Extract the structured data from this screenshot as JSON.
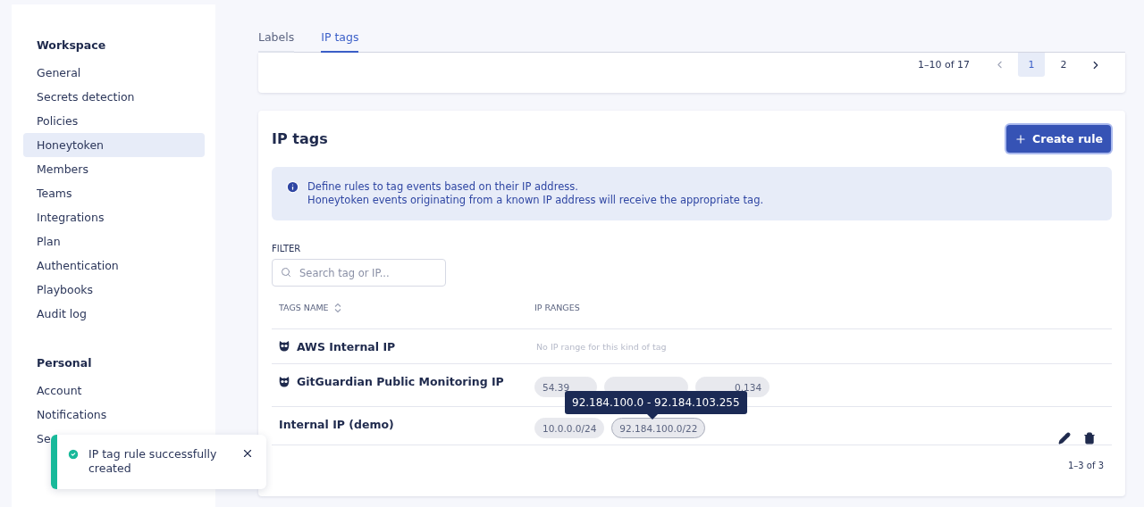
{
  "sidebar": {
    "sections": [
      {
        "title": "Workspace",
        "items": [
          {
            "label": "General",
            "selected": false
          },
          {
            "label": "Secrets detection",
            "selected": false
          },
          {
            "label": "Policies",
            "selected": false
          },
          {
            "label": "Honeytoken",
            "selected": true
          },
          {
            "label": "Members",
            "selected": false
          },
          {
            "label": "Teams",
            "selected": false
          },
          {
            "label": "Integrations",
            "selected": false
          },
          {
            "label": "Plan",
            "selected": false
          },
          {
            "label": "Authentication",
            "selected": false
          },
          {
            "label": "Playbooks",
            "selected": false
          },
          {
            "label": "Audit log",
            "selected": false
          }
        ]
      },
      {
        "title": "Personal",
        "items": [
          {
            "label": "Account",
            "selected": false
          },
          {
            "label": "Notifications",
            "selected": false
          },
          {
            "label": "Se",
            "selected": false
          }
        ]
      }
    ]
  },
  "tabs": [
    {
      "label": "Labels",
      "selected": false
    },
    {
      "label": "IP tags",
      "selected": true
    }
  ],
  "top_pagination": {
    "range": "1–10 of 17",
    "pages": [
      {
        "label": "1",
        "selected": true
      },
      {
        "label": "2",
        "selected": false
      }
    ]
  },
  "ip_tags": {
    "title": "IP tags",
    "create_button": "Create rule",
    "info": [
      "Define rules to tag events based on their IP address.",
      "Honeytoken events originating from a known IP address will receive the appropriate tag."
    ],
    "filter": {
      "label": "FILTER",
      "placeholder": "Search tag or IP..."
    },
    "columns": [
      "TAGS NAME",
      "IP RANGES"
    ],
    "rows": [
      {
        "name": "AWS Internal IP",
        "builtin": true,
        "empty_note": "No IP range for this kind of tag"
      },
      {
        "name": "GitGuardian Public Monitoring IP",
        "builtin": true,
        "ranges": [
          {
            "text": "54.39",
            "cut_left": false,
            "cut_right": true
          },
          {
            "cut_left": true,
            "cut_right": true
          },
          {
            "text": "0.134",
            "cut_left": true,
            "cut_right": false
          }
        ]
      },
      {
        "name": "Internal IP (demo)",
        "builtin": false,
        "editable": true,
        "ranges": [
          {
            "text": "10.0.0.0/24",
            "hovered": false
          },
          {
            "text": "92.184.100.0/22",
            "hovered": true
          }
        ],
        "tooltip": "92.184.100.0 - 92.184.103.255"
      }
    ],
    "footer": "1–3 of 3"
  },
  "toast": {
    "message": "IP tag rule successfully created"
  }
}
